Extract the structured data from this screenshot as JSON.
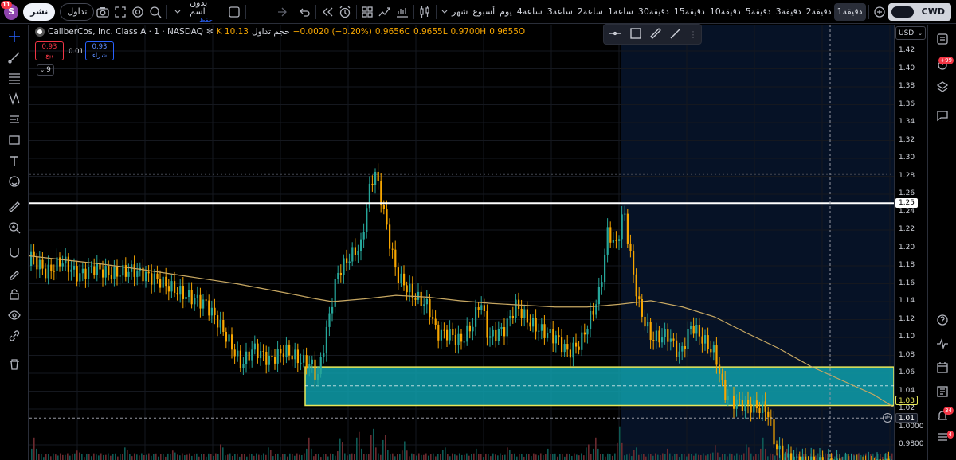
{
  "app": {
    "logo_letter": "S",
    "notifications": "11",
    "publish_label": "نشر",
    "trade_label": "تداول",
    "layout_name": "بدون اسم",
    "layout_sub": "حفظ",
    "account_label": "CWD"
  },
  "timeframes": [
    {
      "label": "شهر",
      "active": false
    },
    {
      "label": "أسبوع",
      "active": false
    },
    {
      "label": "يوم",
      "active": false
    },
    {
      "label": "4ساعة",
      "active": false
    },
    {
      "label": "3ساعة",
      "active": false
    },
    {
      "label": "2ساعة",
      "active": false
    },
    {
      "label": "1ساعة",
      "active": false
    },
    {
      "label": "30دقيقة",
      "active": false
    },
    {
      "label": "15دقيقة",
      "active": false
    },
    {
      "label": "10دقيقة",
      "active": false
    },
    {
      "label": "5دقيقة",
      "active": false
    },
    {
      "label": "3دقيقة",
      "active": false
    },
    {
      "label": "2دقيقة",
      "active": false
    },
    {
      "label": "1دقيقة",
      "active": true
    }
  ],
  "legend": {
    "symbol": "CaliberCos, Inc. Class A · 1 · NASDAQ",
    "volume": "K 10.13",
    "volume_label": "حجم تداول",
    "change": "−0.0020 (−0.20%)",
    "close": "0.9656C",
    "low": "0.9655L",
    "high": "0.9700H",
    "open": "0.9655O"
  },
  "trade": {
    "sell_price": "0.93",
    "sell_label": "بيع",
    "buy_price": "0.93",
    "buy_label": "شراء",
    "spread": "0.01",
    "indicator_count": "9"
  },
  "price_scale": {
    "currency": "USD",
    "labels": [
      "1.42",
      "1.40",
      "1.38",
      "1.36",
      "1.34",
      "1.32",
      "1.30",
      "1.28",
      "1.26",
      "1.24",
      "1.22",
      "1.20",
      "1.18",
      "1.16",
      "1.14",
      "1.12",
      "1.10",
      "1.08",
      "1.06",
      "1.04",
      "1.02",
      "1.0000",
      "0.9800"
    ],
    "tag_white": "1.25",
    "tag_yellow": "1.03",
    "tag_crosshair": "1.01"
  },
  "right_panel": {
    "alerts_badge": "+99",
    "notif_badge": "34",
    "bottom_badge": "4"
  },
  "colors": {
    "up": "#26a69a",
    "down": "#f7a600",
    "zone_fill": "#0fa3b1",
    "zone_border": "#e8e85a",
    "ma": "#c8a862",
    "session": "#061226"
  },
  "chart_data": {
    "type": "candlestick",
    "y_range": [
      0.97,
      1.43
    ],
    "horizontal_lines": [
      1.25
    ],
    "zone": {
      "top": 1.067,
      "bottom": 1.024
    },
    "ma_path": [
      [
        0,
        1.191
      ],
      [
        40,
        1.187
      ],
      [
        90,
        1.182
      ],
      [
        140,
        1.176
      ],
      [
        200,
        1.168
      ],
      [
        260,
        1.16
      ],
      [
        320,
        1.15
      ],
      [
        360,
        1.143
      ],
      [
        380,
        1.14
      ],
      [
        420,
        1.143
      ],
      [
        460,
        1.147
      ],
      [
        500,
        1.145
      ],
      [
        540,
        1.141
      ],
      [
        580,
        1.138
      ],
      [
        620,
        1.136
      ],
      [
        660,
        1.134
      ],
      [
        700,
        1.134
      ],
      [
        740,
        1.137
      ],
      [
        780,
        1.141
      ],
      [
        820,
        1.134
      ],
      [
        860,
        1.123
      ],
      [
        900,
        1.105
      ],
      [
        940,
        1.088
      ],
      [
        980,
        1.068
      ],
      [
        1020,
        1.052
      ],
      [
        1060,
        1.036
      ],
      [
        1085,
        1.022
      ]
    ],
    "price_path": [
      [
        0,
        1.18
      ],
      [
        20,
        1.16
      ],
      [
        40,
        1.175
      ],
      [
        60,
        1.16
      ],
      [
        80,
        1.172
      ],
      [
        100,
        1.168
      ],
      [
        130,
        1.178
      ],
      [
        160,
        1.172
      ],
      [
        190,
        1.16
      ],
      [
        220,
        1.15
      ],
      [
        235,
        1.13
      ],
      [
        250,
        1.105
      ],
      [
        265,
        1.078
      ],
      [
        280,
        1.095
      ],
      [
        300,
        1.078
      ],
      [
        320,
        1.085
      ],
      [
        340,
        1.07
      ],
      [
        355,
        1.062
      ],
      [
        360,
        1.045
      ],
      [
        370,
        1.09
      ],
      [
        385,
        1.16
      ],
      [
        400,
        1.178
      ],
      [
        415,
        1.19
      ],
      [
        425,
        1.25
      ],
      [
        432,
        1.275
      ],
      [
        440,
        1.245
      ],
      [
        450,
        1.2
      ],
      [
        460,
        1.16
      ],
      [
        480,
        1.14
      ],
      [
        500,
        1.13
      ],
      [
        510,
        1.102
      ],
      [
        525,
        1.105
      ],
      [
        540,
        1.098
      ],
      [
        555,
        1.12
      ],
      [
        565,
        1.15
      ],
      [
        575,
        1.108
      ],
      [
        595,
        1.12
      ],
      [
        610,
        1.148
      ],
      [
        625,
        1.13
      ],
      [
        640,
        1.12
      ],
      [
        660,
        1.11
      ],
      [
        675,
        1.092
      ],
      [
        690,
        1.1
      ],
      [
        705,
        1.13
      ],
      [
        715,
        1.155
      ],
      [
        725,
        1.22
      ],
      [
        735,
        1.2
      ],
      [
        745,
        1.24
      ],
      [
        755,
        1.175
      ],
      [
        765,
        1.125
      ],
      [
        780,
        1.09
      ],
      [
        800,
        1.092
      ],
      [
        815,
        1.068
      ],
      [
        830,
        1.102
      ],
      [
        845,
        1.085
      ],
      [
        860,
        1.07
      ],
      [
        870,
        1.03
      ],
      [
        880,
        1.02
      ],
      [
        900,
        1.018
      ],
      [
        915,
        1.018
      ],
      [
        925,
        1.018
      ],
      [
        935,
        0.98
      ],
      [
        945,
        0.968
      ],
      [
        970,
        0.968
      ],
      [
        1000,
        0.968
      ],
      [
        1040,
        0.969
      ],
      [
        1084,
        0.9656
      ]
    ],
    "volume_spikes": [
      [
        5,
        0.6
      ],
      [
        60,
        0.3
      ],
      [
        120,
        0.4
      ],
      [
        180,
        0.3
      ],
      [
        240,
        0.5
      ],
      [
        300,
        0.4
      ],
      [
        350,
        0.6
      ],
      [
        390,
        0.7
      ],
      [
        412,
        0.9
      ],
      [
        430,
        1.0
      ],
      [
        445,
        0.8
      ],
      [
        470,
        0.5
      ],
      [
        520,
        0.4
      ],
      [
        560,
        0.3
      ],
      [
        600,
        0.4
      ],
      [
        650,
        0.3
      ],
      [
        700,
        0.5
      ],
      [
        710,
        0.6
      ],
      [
        740,
        0.9
      ],
      [
        760,
        0.4
      ],
      [
        800,
        0.3
      ],
      [
        860,
        0.4
      ],
      [
        900,
        0.5
      ],
      [
        920,
        0.6
      ],
      [
        950,
        0.3
      ],
      [
        1000,
        0.2
      ],
      [
        1050,
        0.2
      ]
    ]
  }
}
